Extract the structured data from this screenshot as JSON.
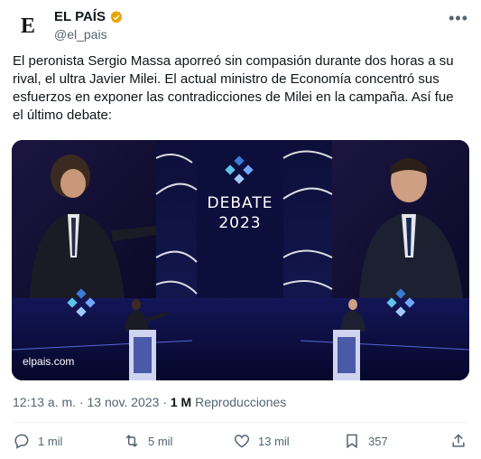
{
  "account": {
    "avatar_letter": "E",
    "display_name": "EL PAÍS",
    "handle": "@el_pais",
    "verified_color": "#e8a400"
  },
  "tweet": {
    "text": "El peronista Sergio Massa aporreó sin compasión durante dos horas a su rival, el ultra Javier Milei. El actual ministro de Economía concentró sus esfuerzos en exponer las contradicciones de Milei en la campaña. Así fue el último debate:"
  },
  "media": {
    "debate_title": "DEBATE",
    "debate_year": "2023",
    "watermark": "elpais.com"
  },
  "meta": {
    "time": "12:13 a. m.",
    "separator": "·",
    "date": "13 nov. 2023",
    "views_count": "1 M",
    "views_label": "Reproducciones"
  },
  "actions": {
    "replies": "1 mil",
    "retweets": "5 mil",
    "likes": "13 mil",
    "bookmarks": "357"
  },
  "colors": {
    "text": "#0f1419",
    "secondary": "#536471",
    "stage_bg": "#0a0a2a",
    "accent_blue": "#3a7bd5"
  }
}
